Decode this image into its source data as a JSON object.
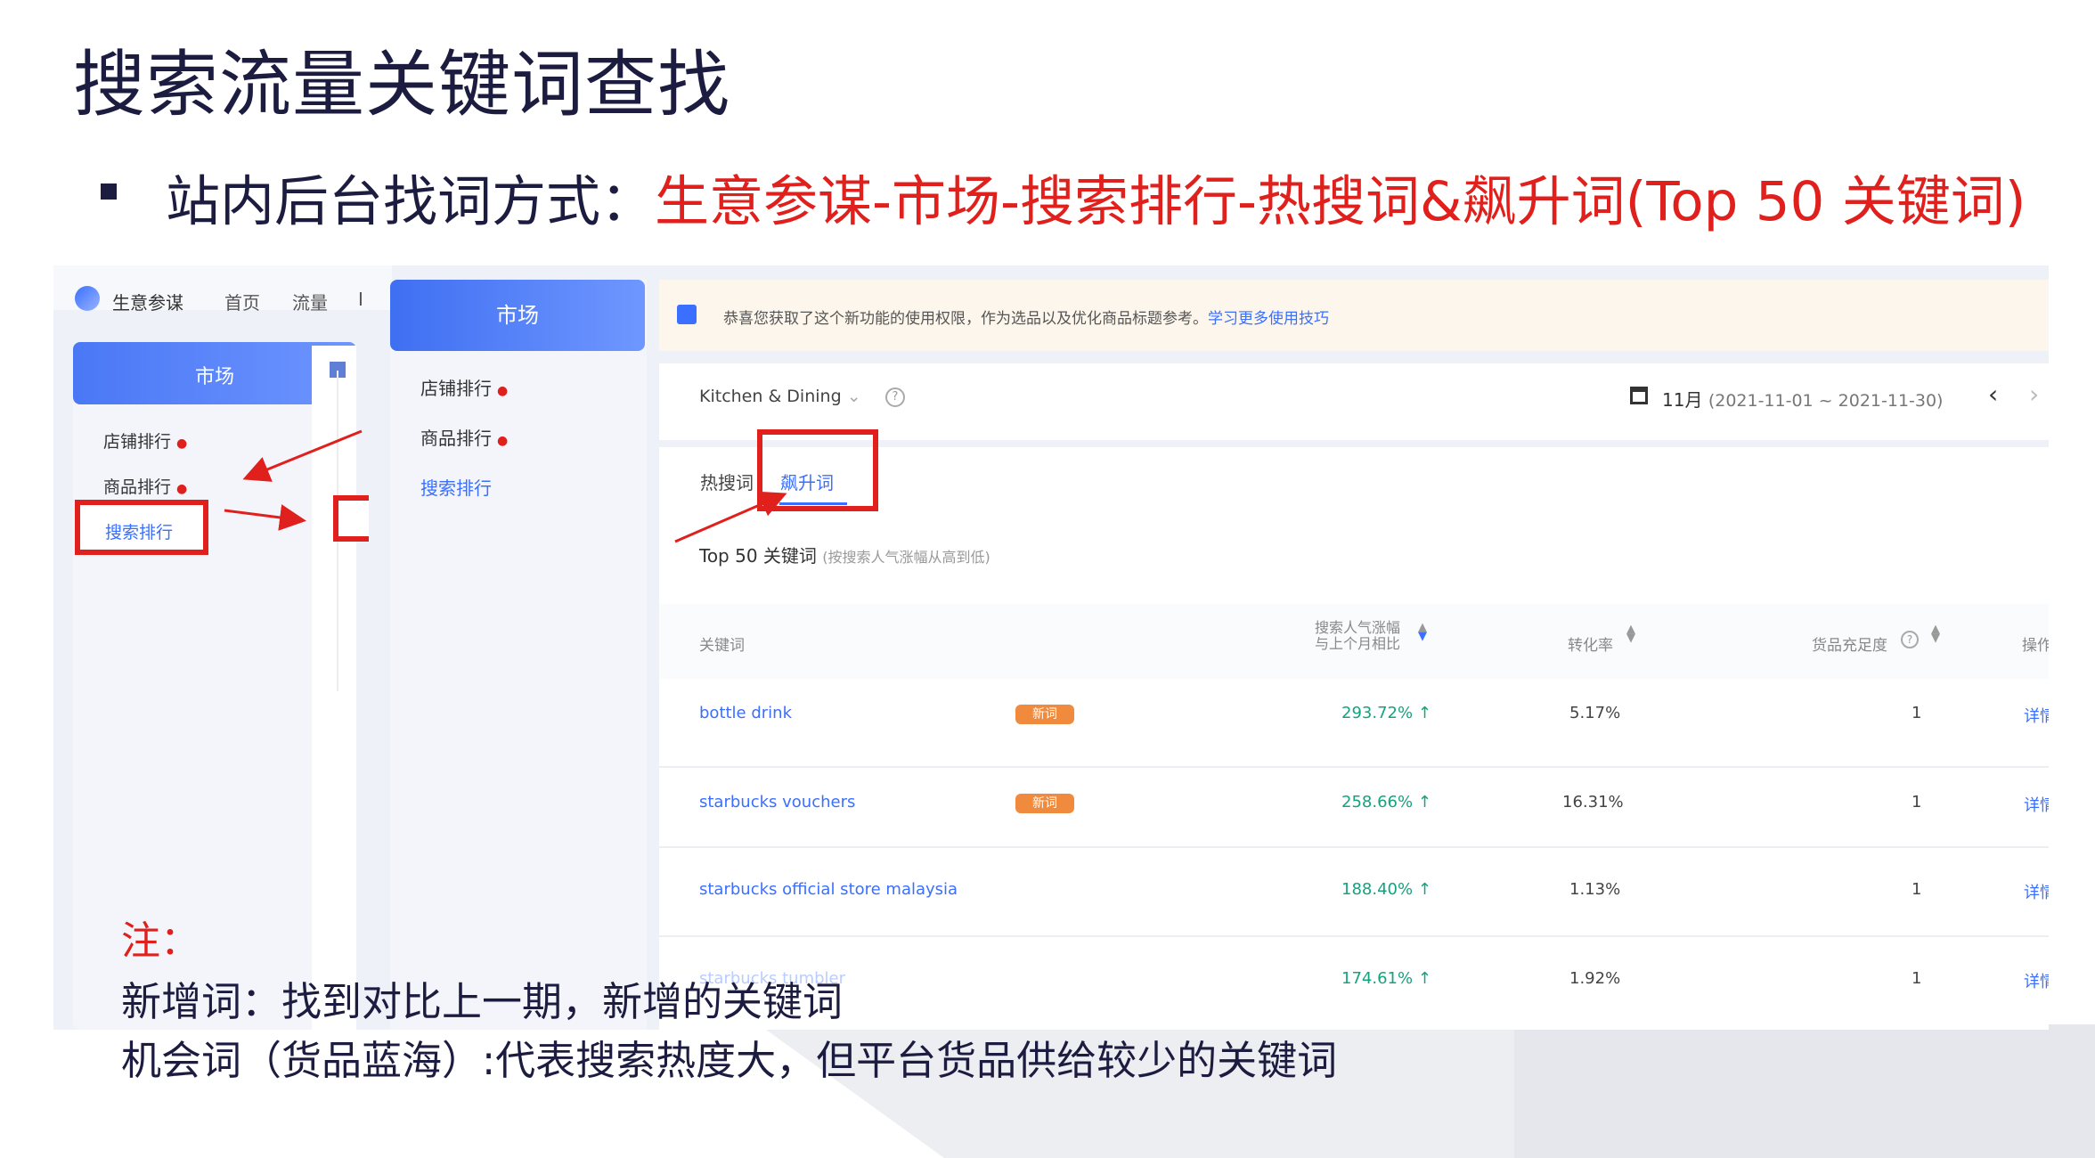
{
  "slide": {
    "title": "搜索流量关键词查找",
    "bullet_prefix": "站内后台找词方式：",
    "bullet_highlight": "生意参谋-市场-搜索排行-热搜词&飙升词(Top 50 关键词)",
    "note_title": "注：",
    "note_line1": "新增词：找到对比上一期，新增的关键词",
    "note_line2": "机会词（货品蓝海）:代表搜索热度大，但平台货品供给较少的关键词"
  },
  "app": {
    "brand": "生意参谋",
    "nav": [
      "首页",
      "流量",
      "I"
    ],
    "market_label": "市场",
    "menu": {
      "shop_rank": "店铺排行",
      "product_rank": "商品排行",
      "search_rank": "搜索排行"
    },
    "notice": "恭喜您获取了这个新功能的使用权限，作为选品以及优化商品标题参考。",
    "notice_link": "学习更多使用技巧",
    "category": "Kitchen & Dining",
    "period_label": "11月",
    "period_range": "(2021-11-01 ~ 2021-11-30)",
    "tabs": {
      "hot": "热搜词",
      "rising": "飙升词"
    },
    "list_title": "Top 50 关键词",
    "list_subtitle": "(按搜索人气涨幅从高到低)",
    "columns": {
      "keyword": "关键词",
      "growth_line1": "搜索人气涨幅",
      "growth_line2": "与上个月相比",
      "conversion": "转化率",
      "supply": "货品充足度",
      "op": "操作"
    },
    "rows": [
      {
        "keyword": "bottle drink",
        "badge": "新词",
        "growth": "293.72%",
        "conversion": "5.17%",
        "supply": "1",
        "op": "详情"
      },
      {
        "keyword": "starbucks vouchers",
        "badge": "新词",
        "growth": "258.66%",
        "conversion": "16.31%",
        "supply": "1",
        "op": "详情"
      },
      {
        "keyword": "starbucks official store malaysia",
        "badge": "",
        "growth": "188.40%",
        "conversion": "1.13%",
        "supply": "1",
        "op": "详情"
      },
      {
        "keyword": "starbucks tumbler",
        "badge": "",
        "growth": "174.61%",
        "conversion": "1.92%",
        "supply": "1",
        "op": "详情"
      }
    ],
    "up_arrow": "↑",
    "help_glyph": "?",
    "colors": {
      "accent": "#3a6fff",
      "highlight_red": "#e0201c",
      "growth_green": "#14a37f",
      "badge_orange": "#f08a3c"
    }
  }
}
